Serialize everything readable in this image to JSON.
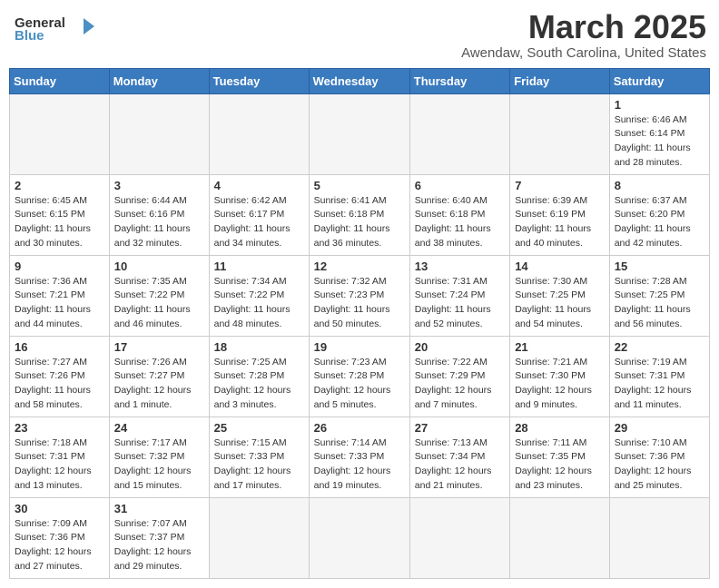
{
  "header": {
    "logo_general": "General",
    "logo_blue": "Blue",
    "month_title": "March 2025",
    "location": "Awendaw, South Carolina, United States"
  },
  "weekdays": [
    "Sunday",
    "Monday",
    "Tuesday",
    "Wednesday",
    "Thursday",
    "Friday",
    "Saturday"
  ],
  "weeks": [
    [
      {
        "day": "",
        "info": ""
      },
      {
        "day": "",
        "info": ""
      },
      {
        "day": "",
        "info": ""
      },
      {
        "day": "",
        "info": ""
      },
      {
        "day": "",
        "info": ""
      },
      {
        "day": "",
        "info": ""
      },
      {
        "day": "1",
        "info": "Sunrise: 6:46 AM\nSunset: 6:14 PM\nDaylight: 11 hours\nand 28 minutes."
      }
    ],
    [
      {
        "day": "2",
        "info": "Sunrise: 6:45 AM\nSunset: 6:15 PM\nDaylight: 11 hours\nand 30 minutes."
      },
      {
        "day": "3",
        "info": "Sunrise: 6:44 AM\nSunset: 6:16 PM\nDaylight: 11 hours\nand 32 minutes."
      },
      {
        "day": "4",
        "info": "Sunrise: 6:42 AM\nSunset: 6:17 PM\nDaylight: 11 hours\nand 34 minutes."
      },
      {
        "day": "5",
        "info": "Sunrise: 6:41 AM\nSunset: 6:18 PM\nDaylight: 11 hours\nand 36 minutes."
      },
      {
        "day": "6",
        "info": "Sunrise: 6:40 AM\nSunset: 6:18 PM\nDaylight: 11 hours\nand 38 minutes."
      },
      {
        "day": "7",
        "info": "Sunrise: 6:39 AM\nSunset: 6:19 PM\nDaylight: 11 hours\nand 40 minutes."
      },
      {
        "day": "8",
        "info": "Sunrise: 6:37 AM\nSunset: 6:20 PM\nDaylight: 11 hours\nand 42 minutes."
      }
    ],
    [
      {
        "day": "9",
        "info": "Sunrise: 7:36 AM\nSunset: 7:21 PM\nDaylight: 11 hours\nand 44 minutes."
      },
      {
        "day": "10",
        "info": "Sunrise: 7:35 AM\nSunset: 7:22 PM\nDaylight: 11 hours\nand 46 minutes."
      },
      {
        "day": "11",
        "info": "Sunrise: 7:34 AM\nSunset: 7:22 PM\nDaylight: 11 hours\nand 48 minutes."
      },
      {
        "day": "12",
        "info": "Sunrise: 7:32 AM\nSunset: 7:23 PM\nDaylight: 11 hours\nand 50 minutes."
      },
      {
        "day": "13",
        "info": "Sunrise: 7:31 AM\nSunset: 7:24 PM\nDaylight: 11 hours\nand 52 minutes."
      },
      {
        "day": "14",
        "info": "Sunrise: 7:30 AM\nSunset: 7:25 PM\nDaylight: 11 hours\nand 54 minutes."
      },
      {
        "day": "15",
        "info": "Sunrise: 7:28 AM\nSunset: 7:25 PM\nDaylight: 11 hours\nand 56 minutes."
      }
    ],
    [
      {
        "day": "16",
        "info": "Sunrise: 7:27 AM\nSunset: 7:26 PM\nDaylight: 11 hours\nand 58 minutes."
      },
      {
        "day": "17",
        "info": "Sunrise: 7:26 AM\nSunset: 7:27 PM\nDaylight: 12 hours\nand 1 minute."
      },
      {
        "day": "18",
        "info": "Sunrise: 7:25 AM\nSunset: 7:28 PM\nDaylight: 12 hours\nand 3 minutes."
      },
      {
        "day": "19",
        "info": "Sunrise: 7:23 AM\nSunset: 7:28 PM\nDaylight: 12 hours\nand 5 minutes."
      },
      {
        "day": "20",
        "info": "Sunrise: 7:22 AM\nSunset: 7:29 PM\nDaylight: 12 hours\nand 7 minutes."
      },
      {
        "day": "21",
        "info": "Sunrise: 7:21 AM\nSunset: 7:30 PM\nDaylight: 12 hours\nand 9 minutes."
      },
      {
        "day": "22",
        "info": "Sunrise: 7:19 AM\nSunset: 7:31 PM\nDaylight: 12 hours\nand 11 minutes."
      }
    ],
    [
      {
        "day": "23",
        "info": "Sunrise: 7:18 AM\nSunset: 7:31 PM\nDaylight: 12 hours\nand 13 minutes."
      },
      {
        "day": "24",
        "info": "Sunrise: 7:17 AM\nSunset: 7:32 PM\nDaylight: 12 hours\nand 15 minutes."
      },
      {
        "day": "25",
        "info": "Sunrise: 7:15 AM\nSunset: 7:33 PM\nDaylight: 12 hours\nand 17 minutes."
      },
      {
        "day": "26",
        "info": "Sunrise: 7:14 AM\nSunset: 7:33 PM\nDaylight: 12 hours\nand 19 minutes."
      },
      {
        "day": "27",
        "info": "Sunrise: 7:13 AM\nSunset: 7:34 PM\nDaylight: 12 hours\nand 21 minutes."
      },
      {
        "day": "28",
        "info": "Sunrise: 7:11 AM\nSunset: 7:35 PM\nDaylight: 12 hours\nand 23 minutes."
      },
      {
        "day": "29",
        "info": "Sunrise: 7:10 AM\nSunset: 7:36 PM\nDaylight: 12 hours\nand 25 minutes."
      }
    ],
    [
      {
        "day": "30",
        "info": "Sunrise: 7:09 AM\nSunset: 7:36 PM\nDaylight: 12 hours\nand 27 minutes."
      },
      {
        "day": "31",
        "info": "Sunrise: 7:07 AM\nSunset: 7:37 PM\nDaylight: 12 hours\nand 29 minutes."
      },
      {
        "day": "",
        "info": ""
      },
      {
        "day": "",
        "info": ""
      },
      {
        "day": "",
        "info": ""
      },
      {
        "day": "",
        "info": ""
      },
      {
        "day": "",
        "info": ""
      }
    ]
  ]
}
